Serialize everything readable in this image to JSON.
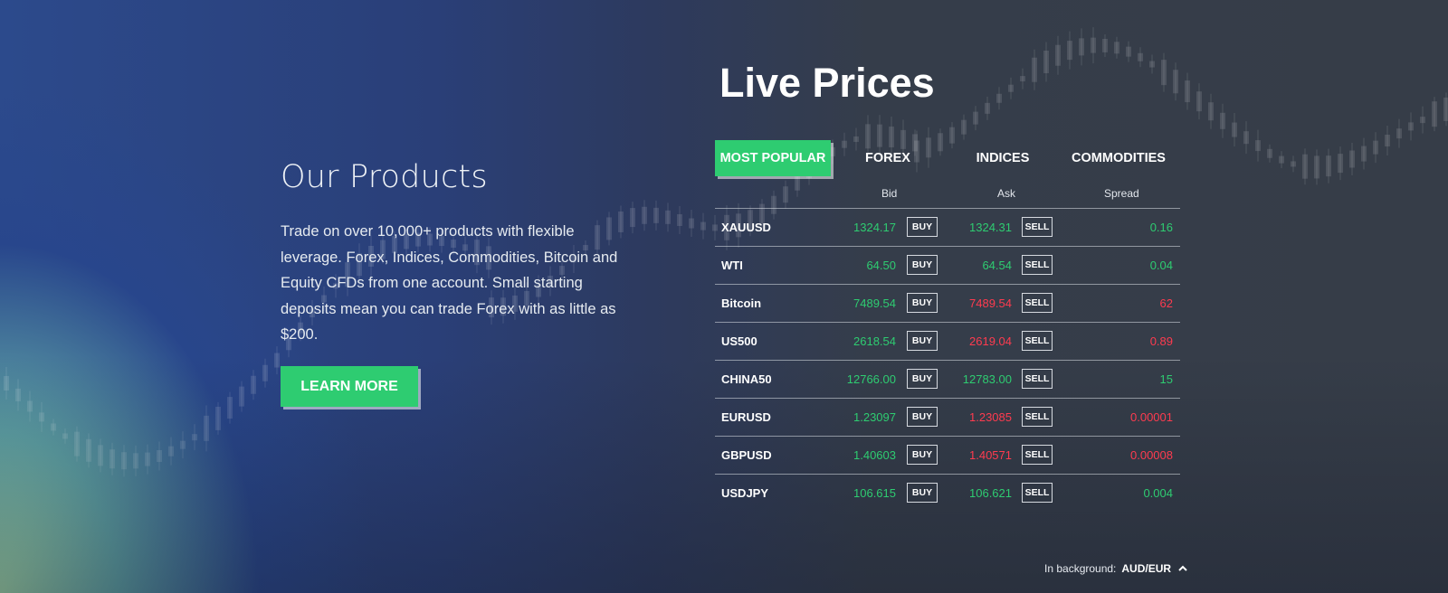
{
  "products": {
    "title": "Our Products",
    "description": "Trade on over 10,000+ products with flexible leverage. Forex, Indices, Commodities, Bitcoin and Equity CFDs from one account. Small starting deposits mean you can trade Forex with as little as $200.",
    "cta_label": "LEARN MORE"
  },
  "live_prices": {
    "title": "Live Prices",
    "tabs": [
      {
        "label": "MOST POPULAR",
        "active": true
      },
      {
        "label": "FOREX",
        "active": false
      },
      {
        "label": "INDICES",
        "active": false
      },
      {
        "label": "COMMODITIES",
        "active": false
      }
    ],
    "columns": {
      "bid": "Bid",
      "ask": "Ask",
      "spread": "Spread"
    },
    "buy_label": "BUY",
    "sell_label": "SELL",
    "rows": [
      {
        "symbol": "XAUUSD",
        "bid": "1324.17",
        "bid_dir": "up",
        "ask": "1324.31",
        "ask_dir": "up",
        "spread": "0.16",
        "spread_dir": "up"
      },
      {
        "symbol": "WTI",
        "bid": "64.50",
        "bid_dir": "up",
        "ask": "64.54",
        "ask_dir": "up",
        "spread": "0.04",
        "spread_dir": "up"
      },
      {
        "symbol": "Bitcoin",
        "bid": "7489.54",
        "bid_dir": "up",
        "ask": "7489.54",
        "ask_dir": "down",
        "spread": "62",
        "spread_dir": "down"
      },
      {
        "symbol": "US500",
        "bid": "2618.54",
        "bid_dir": "up",
        "ask": "2619.04",
        "ask_dir": "down",
        "spread": "0.89",
        "spread_dir": "down"
      },
      {
        "symbol": "CHINA50",
        "bid": "12766.00",
        "bid_dir": "up",
        "ask": "12783.00",
        "ask_dir": "up",
        "spread": "15",
        "spread_dir": "up"
      },
      {
        "symbol": "EURUSD",
        "bid": "1.23097",
        "bid_dir": "up",
        "ask": "1.23085",
        "ask_dir": "down",
        "spread": "0.00001",
        "spread_dir": "down"
      },
      {
        "symbol": "GBPUSD",
        "bid": "1.40603",
        "bid_dir": "up",
        "ask": "1.40571",
        "ask_dir": "down",
        "spread": "0.00008",
        "spread_dir": "down"
      },
      {
        "symbol": "USDJPY",
        "bid": "106.615",
        "bid_dir": "up",
        "ask": "106.621",
        "ask_dir": "up",
        "spread": "0.004",
        "spread_dir": "up"
      }
    ]
  },
  "background_ticker": {
    "label": "In background:",
    "value": "AUD/EUR",
    "icon": "chevron-up-icon"
  },
  "colors": {
    "accent_green": "#2ecc71",
    "price_up": "#2ecc71",
    "price_down": "#ff3b4f"
  }
}
